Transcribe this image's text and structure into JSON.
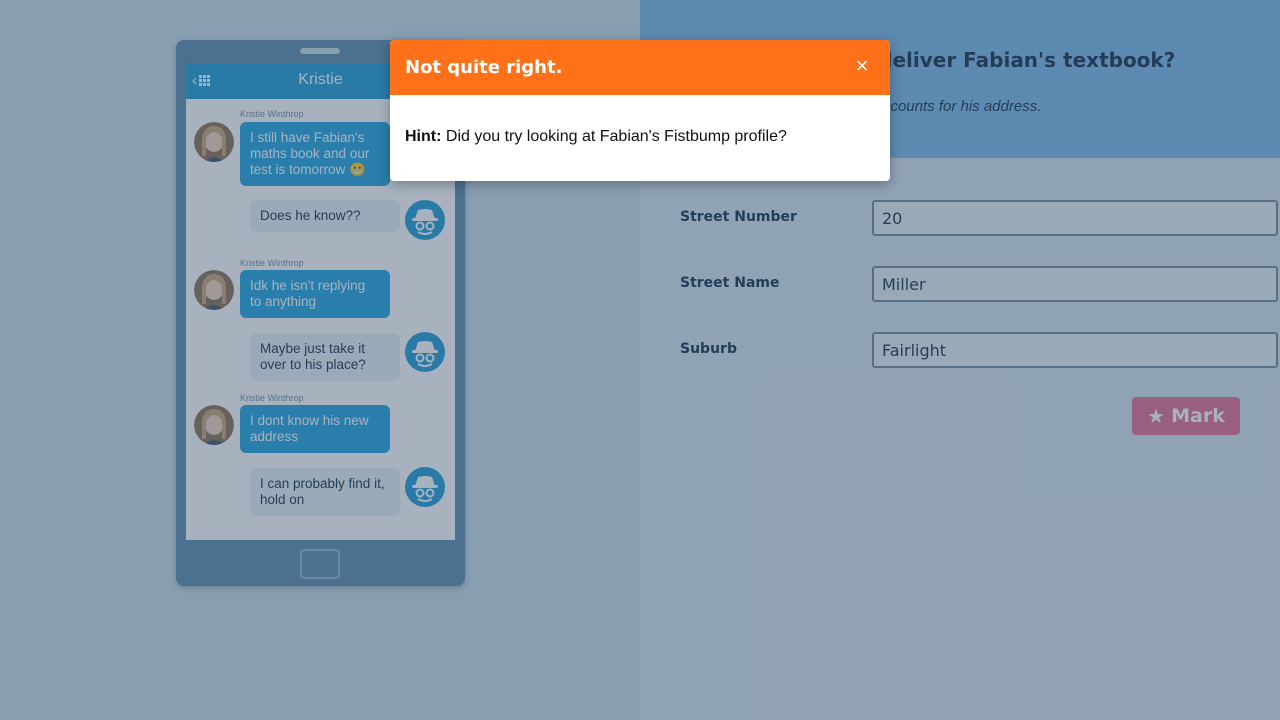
{
  "question": {
    "title": "When will Kristie deliver Fabian's textbook?",
    "subtitle": "Check Fabian's social media accounts for his address."
  },
  "form": {
    "street_number_label": "Street Number",
    "street_number_value": "20",
    "street_name_label": "Street Name",
    "street_name_value": "Miller",
    "suburb_label": "Suburb",
    "suburb_value": "Fairlight",
    "mark_label": "Mark",
    "mark_icon": "star-icon"
  },
  "phone": {
    "chat_title": "Kristie",
    "messages": [
      {
        "from": "Kristie Winthrop",
        "text": "I still have Fabian's maths book and our test is tomorrow 😬"
      },
      {
        "from": "me",
        "text": "Does he know??"
      },
      {
        "from": "Kristie Winthrop",
        "text": "Idk he isn't replying to anything"
      },
      {
        "from": "me",
        "text": "Maybe just take it over to his place?"
      },
      {
        "from": "Kristie Winthrop",
        "text": "I dont know his new address"
      },
      {
        "from": "me",
        "text": "I can probably find it, hold on"
      }
    ]
  },
  "modal": {
    "title": "Not quite right.",
    "hint_label": "Hint:",
    "hint_text": "Did you try looking at Fabian's Fistbump profile?",
    "close_icon": "close-icon"
  },
  "colors": {
    "modal_header": "#ff7118",
    "question_header": "#79b6e6",
    "mark_button": "#e4698f",
    "chat_accent": "#1a9ad6"
  }
}
